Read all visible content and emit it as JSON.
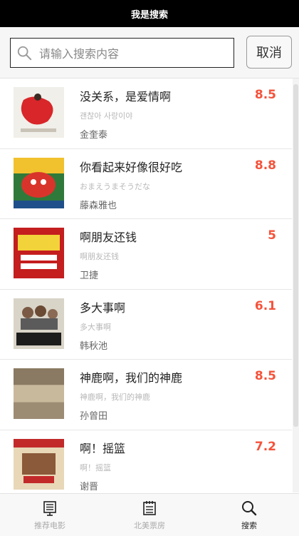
{
  "header": {
    "title": "我是搜索"
  },
  "search": {
    "placeholder": "请输入搜索内容",
    "cancel_label": "取消"
  },
  "movies": [
    {
      "title": "没关系，是爱情啊",
      "original_title": "괜찮아 사랑이야",
      "director": "金奎泰",
      "rating": "8.5"
    },
    {
      "title": "你看起来好像很好吃",
      "original_title": "おまえうまそうだな",
      "director": "藤森雅也",
      "rating": "8.8"
    },
    {
      "title": "啊朋友还钱",
      "original_title": "啊朋友还钱",
      "director": "卫捷",
      "rating": "5"
    },
    {
      "title": "多大事啊",
      "original_title": "多大事啊",
      "director": "韩秋池",
      "rating": "6.1"
    },
    {
      "title": "神鹿啊，我们的神鹿",
      "original_title": "神鹿啊，我们的神鹿",
      "director": "孙曾田",
      "rating": "8.5"
    },
    {
      "title": "啊！摇篮",
      "original_title": "啊！摇篮",
      "director": "谢晋",
      "rating": "7.2"
    }
  ],
  "tabs": [
    {
      "label": "推荐电影",
      "icon": "board-icon",
      "active": false
    },
    {
      "label": "北美票房",
      "icon": "notepad-icon",
      "active": false
    },
    {
      "label": "搜索",
      "icon": "search-icon",
      "active": true
    }
  ],
  "colors": {
    "rating": "#f4533b",
    "header_bg": "#000000"
  }
}
